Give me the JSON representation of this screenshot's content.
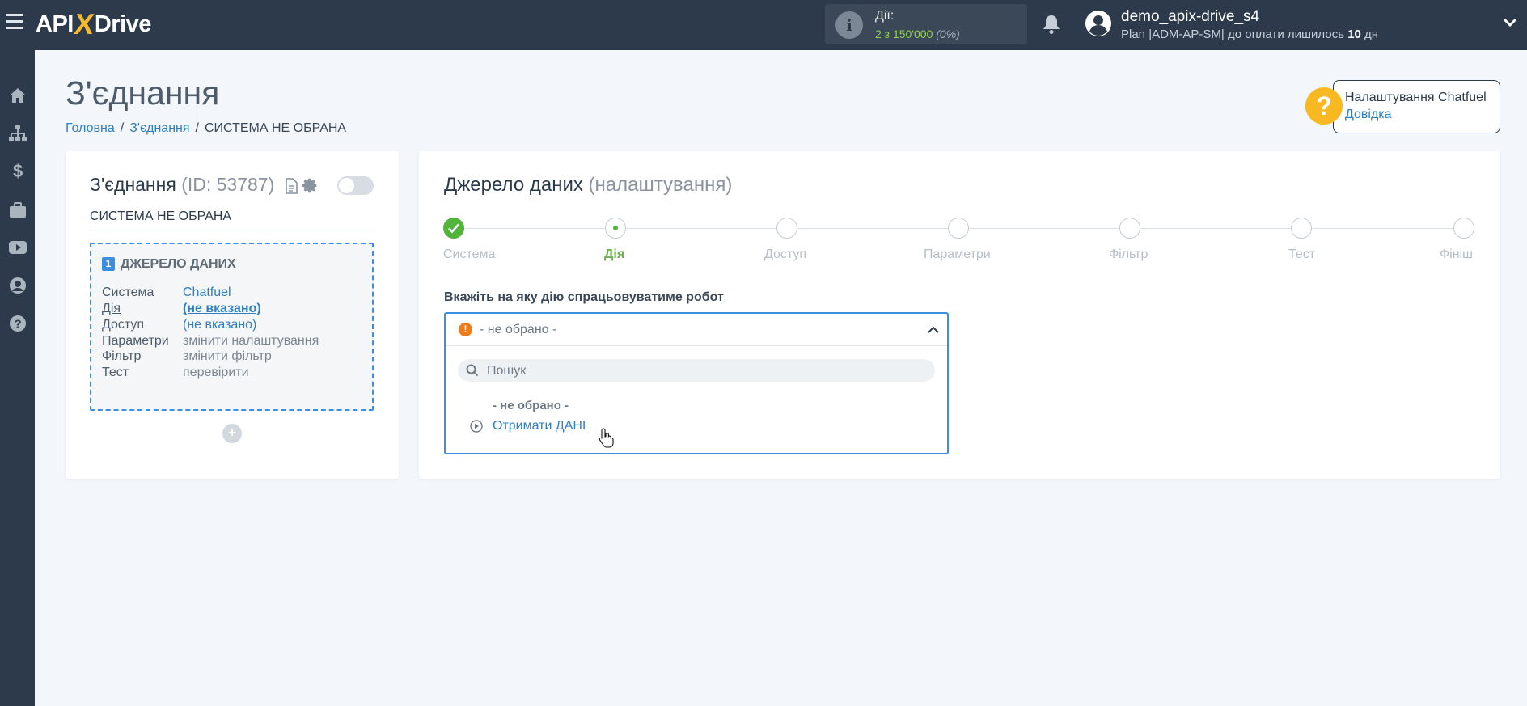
{
  "app": {
    "logo_api": "API",
    "logo_x": "X",
    "logo_drive": "Drive"
  },
  "topbar": {
    "actions_label": "Дії:",
    "actions_count": "2 з 150'000",
    "actions_percent": "(0%)",
    "username": "demo_apix-drive_s4",
    "plan_prefix": "Plan |ADM-AP-SM| до оплати лишилось ",
    "plan_days": "10",
    "plan_suffix": " дн"
  },
  "sidebar": {
    "items": [
      {
        "icon": "home-icon"
      },
      {
        "icon": "sitemap-icon"
      },
      {
        "icon": "dollar-icon"
      },
      {
        "icon": "briefcase-icon"
      },
      {
        "icon": "youtube-icon"
      },
      {
        "icon": "user-icon"
      },
      {
        "icon": "help-icon"
      }
    ]
  },
  "page": {
    "title": "З'єднання",
    "breadcrumb": {
      "home": "Головна",
      "connections": "З'єднання",
      "current": "СИСТЕМА НЕ ОБРАНА"
    }
  },
  "help": {
    "title": "Налаштування Chatfuel",
    "link": "Довідка"
  },
  "connection": {
    "title": "З'єднання",
    "id_label": "(ID: 53787)",
    "system_status": "СИСТЕМА НЕ ОБРАНА",
    "source": {
      "number": "1",
      "title": "ДЖЕРЕЛО ДАНИХ",
      "rows": [
        {
          "key": "Система",
          "value": "Chatfuel"
        },
        {
          "key": "Дія",
          "value": "(не вказано)"
        },
        {
          "key": "Доступ",
          "value": "(не вказано)"
        },
        {
          "key": "Параметри",
          "value": "змінити налаштування"
        },
        {
          "key": "Фільтр",
          "value": "змінити фільтр"
        },
        {
          "key": "Тест",
          "value": "перевірити"
        }
      ]
    },
    "add_label": "+"
  },
  "source_settings": {
    "title": "Джерело даних",
    "subtitle": "(налаштування)",
    "steps": [
      "Система",
      "Дія",
      "Доступ",
      "Параметри",
      "Фільтр",
      "Тест",
      "Фініш"
    ],
    "field_label": "Вкажіть на яку дію спрацьовуватиме робот",
    "dropdown": {
      "selected": "- не обрано -",
      "search_placeholder": "Пошук",
      "options": [
        "- не обрано -",
        "Отримати ДАНІ"
      ]
    }
  },
  "colors": {
    "accent": "#3b8ee0",
    "success": "#52b43c",
    "warning": "#f07b1d",
    "help": "#f8b822",
    "topbar": "#2c3a4b"
  }
}
